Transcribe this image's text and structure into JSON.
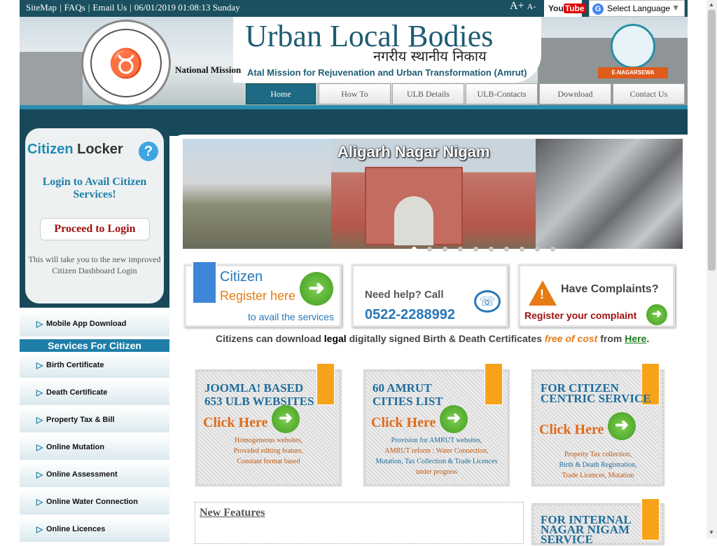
{
  "topbar": {
    "links": [
      "SiteMap",
      "FAQs",
      "Email Us"
    ],
    "datetime": "06/01/2019 01:08:13 Sunday",
    "font_increase": "A+",
    "font_decrease": "A-",
    "youtube": "You Tube",
    "youtube_a": "You",
    "youtube_b": "Tube",
    "language": "Select Language"
  },
  "header": {
    "title": "Urban Local Bodies",
    "hindi_title": "नगरीय स्थानीय निकाय",
    "national_mission": "National Mission",
    "amrut": "Atal Mission for Rejuvenation and Urban Transformation (Amrut)",
    "enagarsewa": "E-NAGARSEWA"
  },
  "nav": [
    {
      "label": "Home",
      "active": true
    },
    {
      "label": "How To",
      "active": false
    },
    {
      "label": "ULB Details",
      "active": false
    },
    {
      "label": "ULB-Contacts",
      "active": false
    },
    {
      "label": "Download",
      "active": false
    },
    {
      "label": "Contact Us",
      "active": false
    }
  ],
  "locker": {
    "title_a": "Citizen",
    "title_b": "Locker",
    "login_avail": "Login to Avail Citizen Services!",
    "proceed": "Proceed to Login",
    "note": "This will take you to the new improved Citizen Dashboard Login"
  },
  "sidebar": {
    "mobile_app": "Mobile App Download",
    "services_heading": "Services For Citizen",
    "items": [
      "Birth Certificate",
      "Death Certificate",
      "Property Tax & Bill",
      "Online Mutation",
      "Online Assessment",
      "Online Water Connection",
      "Online Licences"
    ]
  },
  "slider": {
    "title": "Aligarh Nagar Nigam",
    "dot_count": 10,
    "active_dot": 0
  },
  "infoboxes": {
    "citizen": {
      "line1": "Citizen",
      "line2": "Register here",
      "line3": "to avail the services"
    },
    "help": {
      "line1": "Need help? Call",
      "phone": "0522-2288992"
    },
    "complaints": {
      "line1": "Have Complaints?",
      "line2": "Register your complaint"
    }
  },
  "download_line": {
    "part1": "Citizens can download",
    "legal": "legal",
    "part2": "digitally signed Birth & Death Certificates",
    "free": "free of cost",
    "part3": "from",
    "here": "Here",
    "end": "."
  },
  "cards": [
    {
      "head1": "JOOMLA! BASED",
      "head2": "653 ULB WEBSITES",
      "click": "Click Here",
      "desc": [
        "Homogeneous websites,",
        "Provided editing feature,",
        "Constant format based"
      ]
    },
    {
      "head1": "60 AMRUT",
      "head2": "CITIES LIST",
      "click": "Click Here",
      "desc": [
        "Provision for AMRUT websites,",
        "AMRUT reform : Water Connection,",
        "Mutation, Tax Collection & Trade Licences",
        "under progress"
      ]
    },
    {
      "head1": "FOR CITIZEN",
      "head2": "CENTRIC SERVICE",
      "click": "Click Here",
      "desc": [
        "Property Tax collection,",
        "Birth & Death Registration,",
        "Trade Licences, Mutation"
      ]
    },
    {
      "head1": "FOR INTERNAL",
      "head2": "NAGAR NIGAM",
      "head3": "SERVICE"
    }
  ],
  "new_features": "New Features",
  "colors": {
    "topbar": "#1a5060",
    "nav_active": "#1e6a84",
    "accent_orange": "#e77c14",
    "link_blue": "#1f7ea8"
  }
}
